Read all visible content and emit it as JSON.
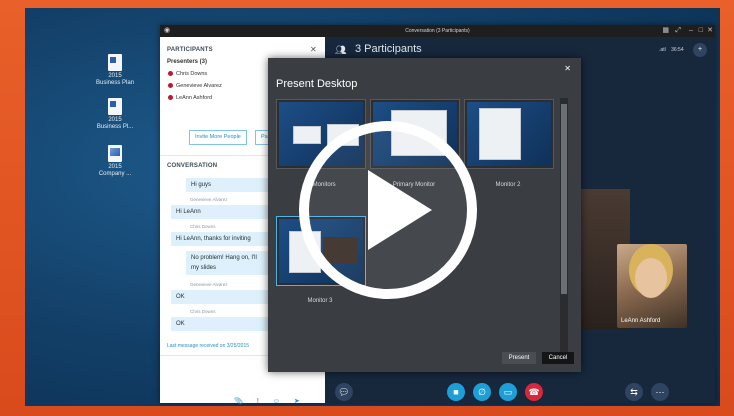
{
  "window": {
    "title": "Conversation (3 Participants)",
    "signal": ".atl",
    "time": "36:54"
  },
  "desktop_icons": [
    {
      "label": "2015 Business Plan",
      "line1": "2015",
      "line2": "Business Plan"
    },
    {
      "label": "2015 Business Pl...",
      "line1": "2015",
      "line2": "Business Pl..."
    },
    {
      "label": "2015 Company ...",
      "line1": "2015",
      "line2": "Company ..."
    }
  ],
  "participants_panel": {
    "title": "PARTICIPANTS",
    "presenters_label": "Presenters (3)",
    "people": [
      "Chris Downs",
      "Genevieve Alvarez",
      "LeAnn Ashford"
    ],
    "invite_label": "Invite More People",
    "actions_label": "Participant Actions"
  },
  "conversation": {
    "title": "CONVERSATION",
    "messages": [
      {
        "sender": "",
        "text": "Hi guys"
      },
      {
        "sender": "Genevieve Alvarez",
        "text": "Hi LeAnn"
      },
      {
        "sender": "Chris Downs",
        "text": "Hi LeAnn, thanks for inviting"
      },
      {
        "sender": "",
        "text": "No problem! Hang on, I'll"
      },
      {
        "sender": "",
        "text": "my slides"
      },
      {
        "sender": "Genevieve Alvarez",
        "text": "OK"
      },
      {
        "sender": "Chris Downs",
        "text": "OK"
      }
    ],
    "last_message": "Last message received on 3/25/2015"
  },
  "call": {
    "participants_label": "3 Participants",
    "video_name": "LeAnn Ashford"
  },
  "present_dialog": {
    "title": "Present Desktop",
    "monitors": [
      "All Monitors",
      "Primary Monitor",
      "Monitor 2",
      "Monitor 3"
    ],
    "present_label": "Present",
    "cancel_label": "Cancel"
  },
  "colors": {
    "accent": "#2a8fc6",
    "hangup": "#d6283a",
    "frame": "#e2531f"
  }
}
